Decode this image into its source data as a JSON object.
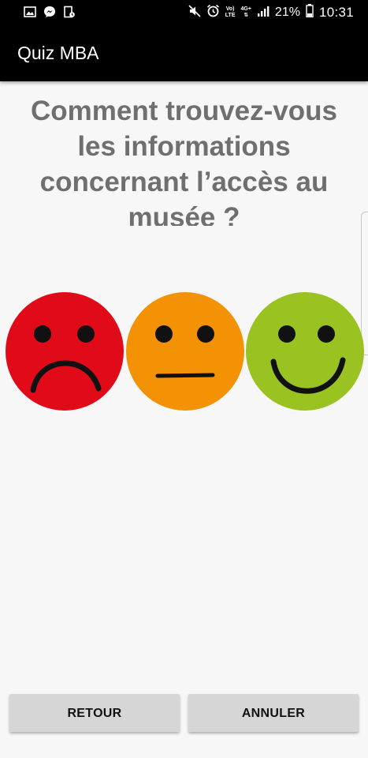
{
  "status_bar": {
    "time": "10:31",
    "battery_percent": "21%",
    "network_top": "Vo)",
    "network_bottom": "LTE",
    "network_type": "4G+",
    "left_icons": [
      "image-icon",
      "messenger-icon",
      "battery-saver-icon"
    ],
    "right_icons": [
      "mute-icon",
      "alarm-icon",
      "signal-icon",
      "battery-icon"
    ]
  },
  "app_bar": {
    "title": "Quiz MBA"
  },
  "question": {
    "text": "Comment trouvez-vous les informations concernant l’accès au musée ?"
  },
  "faces": [
    {
      "name": "sad",
      "color": "#e10a19"
    },
    {
      "name": "neutral",
      "color": "#f29204"
    },
    {
      "name": "happy",
      "color": "#9ac221"
    }
  ],
  "buttons": {
    "back": "RETOUR",
    "cancel": "ANNULER"
  }
}
